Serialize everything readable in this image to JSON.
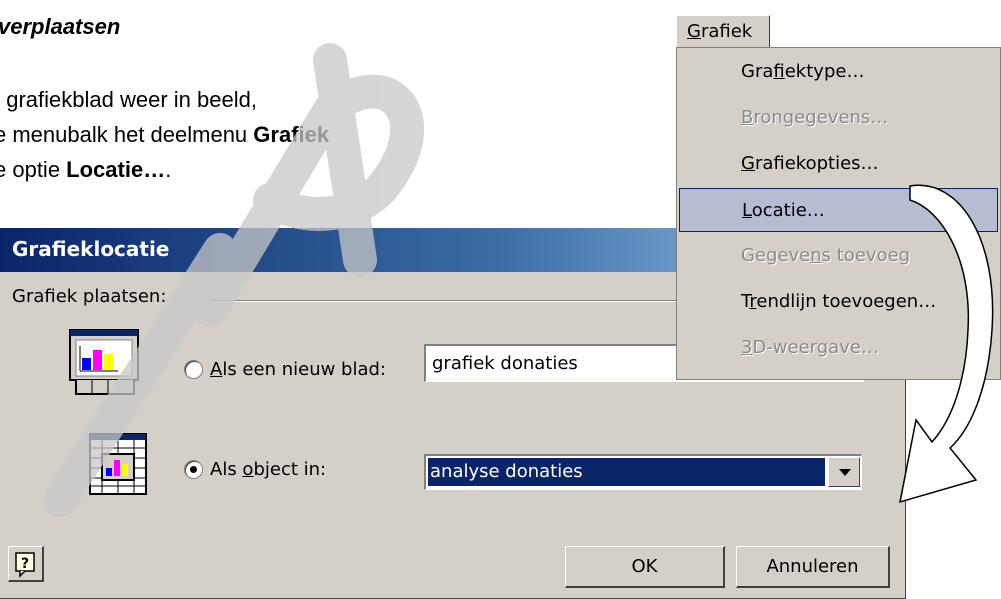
{
  "document": {
    "heading": "verplaatsen",
    "line1": "t grafiekblad weer in beeld,",
    "line2_prefix": "e menubalk het deelmenu ",
    "line2_bold": "Grafiek",
    "line3_prefix": "e optie ",
    "line3_bold": "Locatie…",
    "line3_suffix": "."
  },
  "dialog": {
    "title": "Grafieklocatie",
    "group_label": "Grafiek plaatsen:",
    "option_new_sheet": {
      "label_pre": "",
      "mnemonic": "A",
      "label_post": "ls een nieuw blad:",
      "selected": false
    },
    "new_sheet_value": "grafiek donaties",
    "option_object": {
      "label_pre": "Als ",
      "mnemonic": "o",
      "label_post": "bject in:",
      "selected": true
    },
    "object_value": "analyse donaties",
    "ok_label": "OK",
    "cancel_label": "Annuleren"
  },
  "menu": {
    "title_mnemonic": "G",
    "title_rest": "rafiek",
    "items": [
      {
        "pre": "Gra",
        "mn": "f",
        "post": "iektype…",
        "state": "enabled"
      },
      {
        "pre": "",
        "mn": "B",
        "post": "rongegevens…",
        "state": "disabled"
      },
      {
        "pre": "",
        "mn": "G",
        "post": "rafiekopties…",
        "state": "enabled"
      },
      {
        "pre": "",
        "mn": "L",
        "post": "ocatie…",
        "state": "selected"
      },
      {
        "pre": "Gegeve",
        "mn": "n",
        "post": "s toevoeg",
        "state": "disabled"
      },
      {
        "pre": "T",
        "mn": "r",
        "post": "endlijn toevoegen…",
        "state": "enabled"
      },
      {
        "pre": "",
        "mn": "3",
        "post": "D-weergave…",
        "state": "disabled"
      }
    ]
  },
  "colors": {
    "titlebar_start": "#0a246a",
    "titlebar_end": "#a6caf0",
    "face": "#d4d0c8",
    "selection": "#0a246a",
    "menu_highlight": "#b6bdd2"
  },
  "icons": [
    "chart-sheet-icon",
    "embedded-chart-icon",
    "help-icon",
    "curved-arrow-icon"
  ]
}
